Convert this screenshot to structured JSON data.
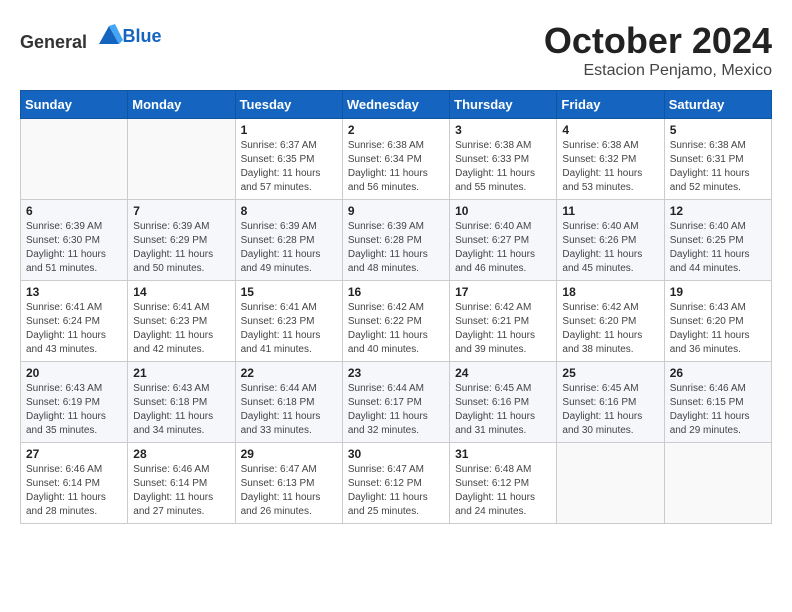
{
  "logo": {
    "text_general": "General",
    "text_blue": "Blue"
  },
  "title": "October 2024",
  "subtitle": "Estacion Penjamo, Mexico",
  "weekdays": [
    "Sunday",
    "Monday",
    "Tuesday",
    "Wednesday",
    "Thursday",
    "Friday",
    "Saturday"
  ],
  "weeks": [
    [
      {
        "day": "",
        "info": ""
      },
      {
        "day": "",
        "info": ""
      },
      {
        "day": "1",
        "info": "Sunrise: 6:37 AM\nSunset: 6:35 PM\nDaylight: 11 hours and 57 minutes."
      },
      {
        "day": "2",
        "info": "Sunrise: 6:38 AM\nSunset: 6:34 PM\nDaylight: 11 hours and 56 minutes."
      },
      {
        "day": "3",
        "info": "Sunrise: 6:38 AM\nSunset: 6:33 PM\nDaylight: 11 hours and 55 minutes."
      },
      {
        "day": "4",
        "info": "Sunrise: 6:38 AM\nSunset: 6:32 PM\nDaylight: 11 hours and 53 minutes."
      },
      {
        "day": "5",
        "info": "Sunrise: 6:38 AM\nSunset: 6:31 PM\nDaylight: 11 hours and 52 minutes."
      }
    ],
    [
      {
        "day": "6",
        "info": "Sunrise: 6:39 AM\nSunset: 6:30 PM\nDaylight: 11 hours and 51 minutes."
      },
      {
        "day": "7",
        "info": "Sunrise: 6:39 AM\nSunset: 6:29 PM\nDaylight: 11 hours and 50 minutes."
      },
      {
        "day": "8",
        "info": "Sunrise: 6:39 AM\nSunset: 6:28 PM\nDaylight: 11 hours and 49 minutes."
      },
      {
        "day": "9",
        "info": "Sunrise: 6:39 AM\nSunset: 6:28 PM\nDaylight: 11 hours and 48 minutes."
      },
      {
        "day": "10",
        "info": "Sunrise: 6:40 AM\nSunset: 6:27 PM\nDaylight: 11 hours and 46 minutes."
      },
      {
        "day": "11",
        "info": "Sunrise: 6:40 AM\nSunset: 6:26 PM\nDaylight: 11 hours and 45 minutes."
      },
      {
        "day": "12",
        "info": "Sunrise: 6:40 AM\nSunset: 6:25 PM\nDaylight: 11 hours and 44 minutes."
      }
    ],
    [
      {
        "day": "13",
        "info": "Sunrise: 6:41 AM\nSunset: 6:24 PM\nDaylight: 11 hours and 43 minutes."
      },
      {
        "day": "14",
        "info": "Sunrise: 6:41 AM\nSunset: 6:23 PM\nDaylight: 11 hours and 42 minutes."
      },
      {
        "day": "15",
        "info": "Sunrise: 6:41 AM\nSunset: 6:23 PM\nDaylight: 11 hours and 41 minutes."
      },
      {
        "day": "16",
        "info": "Sunrise: 6:42 AM\nSunset: 6:22 PM\nDaylight: 11 hours and 40 minutes."
      },
      {
        "day": "17",
        "info": "Sunrise: 6:42 AM\nSunset: 6:21 PM\nDaylight: 11 hours and 39 minutes."
      },
      {
        "day": "18",
        "info": "Sunrise: 6:42 AM\nSunset: 6:20 PM\nDaylight: 11 hours and 38 minutes."
      },
      {
        "day": "19",
        "info": "Sunrise: 6:43 AM\nSunset: 6:20 PM\nDaylight: 11 hours and 36 minutes."
      }
    ],
    [
      {
        "day": "20",
        "info": "Sunrise: 6:43 AM\nSunset: 6:19 PM\nDaylight: 11 hours and 35 minutes."
      },
      {
        "day": "21",
        "info": "Sunrise: 6:43 AM\nSunset: 6:18 PM\nDaylight: 11 hours and 34 minutes."
      },
      {
        "day": "22",
        "info": "Sunrise: 6:44 AM\nSunset: 6:18 PM\nDaylight: 11 hours and 33 minutes."
      },
      {
        "day": "23",
        "info": "Sunrise: 6:44 AM\nSunset: 6:17 PM\nDaylight: 11 hours and 32 minutes."
      },
      {
        "day": "24",
        "info": "Sunrise: 6:45 AM\nSunset: 6:16 PM\nDaylight: 11 hours and 31 minutes."
      },
      {
        "day": "25",
        "info": "Sunrise: 6:45 AM\nSunset: 6:16 PM\nDaylight: 11 hours and 30 minutes."
      },
      {
        "day": "26",
        "info": "Sunrise: 6:46 AM\nSunset: 6:15 PM\nDaylight: 11 hours and 29 minutes."
      }
    ],
    [
      {
        "day": "27",
        "info": "Sunrise: 6:46 AM\nSunset: 6:14 PM\nDaylight: 11 hours and 28 minutes."
      },
      {
        "day": "28",
        "info": "Sunrise: 6:46 AM\nSunset: 6:14 PM\nDaylight: 11 hours and 27 minutes."
      },
      {
        "day": "29",
        "info": "Sunrise: 6:47 AM\nSunset: 6:13 PM\nDaylight: 11 hours and 26 minutes."
      },
      {
        "day": "30",
        "info": "Sunrise: 6:47 AM\nSunset: 6:12 PM\nDaylight: 11 hours and 25 minutes."
      },
      {
        "day": "31",
        "info": "Sunrise: 6:48 AM\nSunset: 6:12 PM\nDaylight: 11 hours and 24 minutes."
      },
      {
        "day": "",
        "info": ""
      },
      {
        "day": "",
        "info": ""
      }
    ]
  ]
}
